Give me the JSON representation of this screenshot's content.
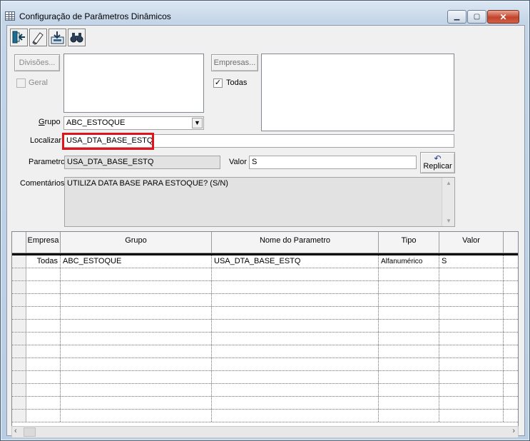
{
  "window": {
    "title": "Configuração de Parâmetros Dinâmicos",
    "minimize_icon": "minimize-icon",
    "maximize_icon": "maximize-icon",
    "close_icon": "close-icon"
  },
  "toolbar": {
    "icons": [
      "exit-icon",
      "eraser-icon",
      "save-icon",
      "binoculars-search-icon"
    ]
  },
  "filters": {
    "divisoes_button": "Divisões...",
    "geral_label": "Geral",
    "geral_checked": false,
    "empresas_button": "Empresas...",
    "todas_label": "Todas",
    "todas_checked": true,
    "grupo_label": "Grupo",
    "grupo_value": "ABC_ESTOQUE",
    "localizar_label": "Localizar",
    "localizar_value": "USA_DTA_BASE_ESTQ",
    "parametro_label": "Parametro",
    "parametro_value": "USA_DTA_BASE_ESTQ",
    "valor_label": "Valor",
    "valor_value": "S",
    "replicar_button": "Replicar",
    "comentarios_label": "Comentários",
    "comentarios_value": "UTILIZA DATA BASE PARA ESTOQUE? (S/N)"
  },
  "grid": {
    "columns": [
      "Empresa",
      "Grupo",
      "Nome do Parametro",
      "Tipo",
      "Valor"
    ],
    "rows": [
      {
        "empresa": "Todas",
        "grupo": "ABC_ESTOQUE",
        "nome": "USA_DTA_BASE_ESTQ",
        "tipo": "Alfanumérico",
        "valor": "S"
      }
    ],
    "empty_rows": 12
  },
  "colors": {
    "highlight": "#e0141a",
    "titlebar": "#c4d5e8",
    "close_button": "#c4422a"
  }
}
